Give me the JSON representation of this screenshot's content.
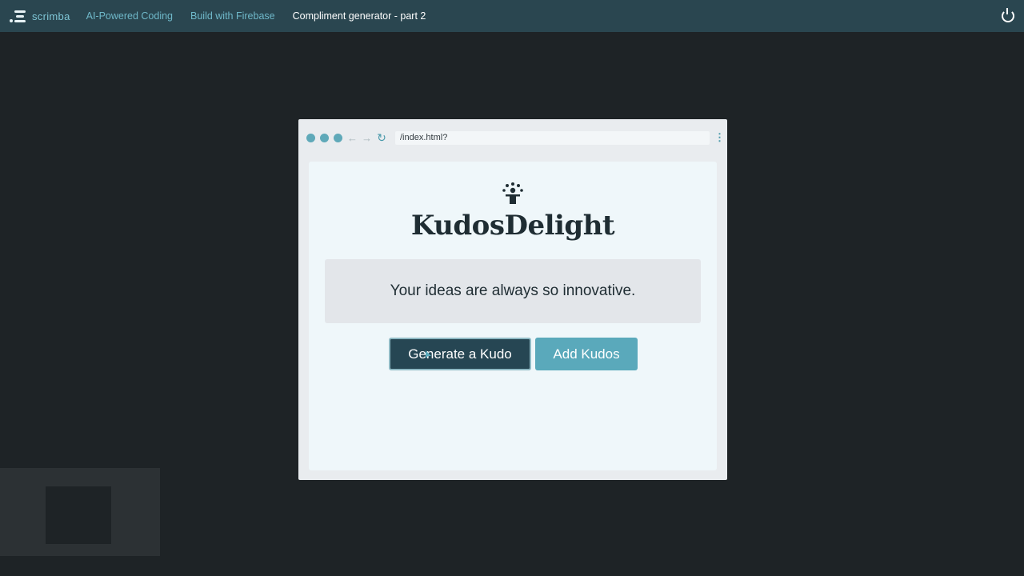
{
  "topbar": {
    "logo_text": "scrimba",
    "breadcrumbs": [
      {
        "label": "AI-Powered Coding"
      },
      {
        "label": "Build with Firebase"
      },
      {
        "label": "Compliment generator - part 2"
      }
    ],
    "power_icon": "power-icon"
  },
  "browser": {
    "url": "/index.html?",
    "nav_icons": [
      "back-arrow-icon",
      "forward-arrow-icon",
      "reload-icon",
      "kebab-menu-icon"
    ]
  },
  "app": {
    "brand_title": "KudosDelight",
    "brand_icon": "celebrating-person-icon",
    "kudo_text": "Your ideas are always so innovative.",
    "generate_label": "Generate a Kudo",
    "add_label": "Add Kudos"
  },
  "colors": {
    "topbar": "#2a4650",
    "background": "#1e2326",
    "accent": "#5aa9bb",
    "primary_button": "#264653"
  }
}
